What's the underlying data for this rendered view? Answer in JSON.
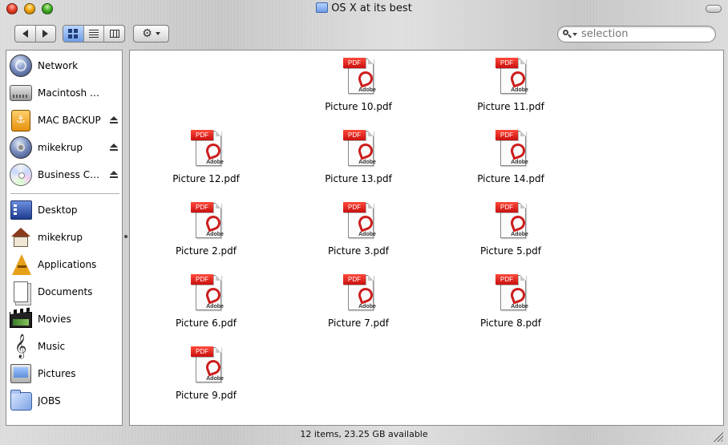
{
  "window": {
    "title": "OS X at its best"
  },
  "toolbar": {
    "back_icon": "back-arrow-icon",
    "forward_icon": "forward-arrow-icon",
    "view_modes": [
      "icon-view",
      "list-view",
      "column-view"
    ],
    "active_view": "icon-view",
    "action_icon": "gear-icon"
  },
  "search": {
    "placeholder": "selection",
    "value": ""
  },
  "sidebar": {
    "devices": [
      {
        "label": "Network",
        "icon": "network-globe-icon",
        "eject": false
      },
      {
        "label": "Macintosh HD",
        "icon": "hard-drive-icon",
        "eject": false
      },
      {
        "label": "MAC BACKUP",
        "icon": "usb-drive-icon",
        "eject": true
      },
      {
        "label": "mikekrup",
        "icon": "idisk-icon",
        "eject": true
      },
      {
        "label": "Business Ca...",
        "icon": "cd-disc-icon",
        "eject": true
      }
    ],
    "places": [
      {
        "label": "Desktop",
        "icon": "desktop-icon"
      },
      {
        "label": "mikekrup",
        "icon": "home-icon"
      },
      {
        "label": "Applications",
        "icon": "applications-icon"
      },
      {
        "label": "Documents",
        "icon": "documents-icon"
      },
      {
        "label": "Movies",
        "icon": "movies-icon"
      },
      {
        "label": "Music",
        "icon": "music-icon"
      },
      {
        "label": "Pictures",
        "icon": "pictures-icon"
      },
      {
        "label": "JOBS",
        "icon": "folder-icon"
      }
    ]
  },
  "files": [
    {
      "name": "Picture 10.pdf",
      "badge": "PDF",
      "brand": "Adobe"
    },
    {
      "name": "Picture 11.pdf",
      "badge": "PDF",
      "brand": "Adobe"
    },
    {
      "name": "Picture 12.pdf",
      "badge": "PDF",
      "brand": "Adobe"
    },
    {
      "name": "Picture 13.pdf",
      "badge": "PDF",
      "brand": "Adobe"
    },
    {
      "name": "Picture 14.pdf",
      "badge": "PDF",
      "brand": "Adobe"
    },
    {
      "name": "Picture 2.pdf",
      "badge": "PDF",
      "brand": "Adobe"
    },
    {
      "name": "Picture 3.pdf",
      "badge": "PDF",
      "brand": "Adobe"
    },
    {
      "name": "Picture 5.pdf",
      "badge": "PDF",
      "brand": "Adobe"
    },
    {
      "name": "Picture 6.pdf",
      "badge": "PDF",
      "brand": "Adobe"
    },
    {
      "name": "Picture 7.pdf",
      "badge": "PDF",
      "brand": "Adobe"
    },
    {
      "name": "Picture 8.pdf",
      "badge": "PDF",
      "brand": "Adobe"
    },
    {
      "name": "Picture 9.pdf",
      "badge": "PDF",
      "brand": "Adobe"
    }
  ],
  "status": {
    "text": "12 items, 23.25 GB available"
  },
  "colors": {
    "selection_blue": "#6f9ee6",
    "pdf_red": "#c90f0f"
  }
}
